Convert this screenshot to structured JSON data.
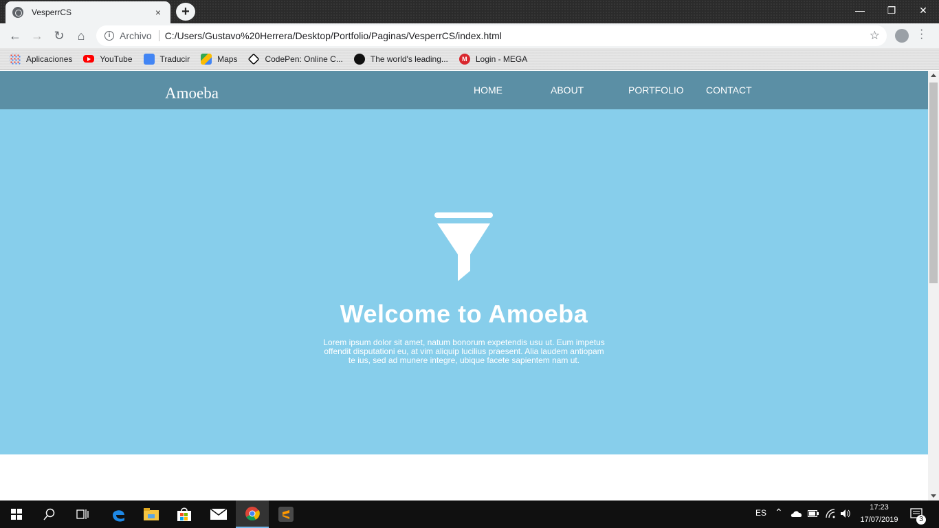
{
  "browser": {
    "tab_title": "VesperrCS",
    "tab_close": "×",
    "new_tab": "+",
    "window_controls": {
      "minimize": "—",
      "restore": "❐",
      "close": "✕"
    },
    "nav": {
      "back": "←",
      "forward": "→",
      "reload": "↻",
      "home": "⌂"
    },
    "omnibox": {
      "security_label": "Archivo",
      "url": "C:/Users/Gustavo%20Herrera/Desktop/Portfolio/Paginas/VesperrCS/index.html",
      "bookmark_star": "☆"
    },
    "bookmarks": [
      {
        "label": "Aplicaciones",
        "icon": "apps-grid-icon"
      },
      {
        "label": "YouTube",
        "icon": "youtube-icon"
      },
      {
        "label": "Traducir",
        "icon": "translate-icon"
      },
      {
        "label": "Maps",
        "icon": "maps-icon"
      },
      {
        "label": "CodePen: Online C...",
        "icon": "codepen-icon"
      },
      {
        "label": "The world's leading...",
        "icon": "github-icon"
      },
      {
        "label": "Login - MEGA",
        "icon": "mega-icon"
      }
    ]
  },
  "site": {
    "brand": "Amoeba",
    "nav": [
      "HOME",
      "ABOUT",
      "PORTFOLIO",
      "CONTACT"
    ],
    "hero": {
      "icon": "funnel-icon",
      "title": "Welcome to Amoeba",
      "text": "Lorem ipsum dolor sit amet, natum bonorum expetendis usu ut. Eum impetus offendit disputationi eu, at vim aliquip lucilius praesent. Alia laudem antiopam te ius, sed ad munere integre, ubique facete sapientem nam ut."
    },
    "colors": {
      "nav_bg": "#5b8fa5",
      "hero_bg": "#87ceeb"
    }
  },
  "taskbar": {
    "apps": [
      "start-icon",
      "search-icon",
      "task-view-icon",
      "edge-icon",
      "file-explorer-icon",
      "store-icon",
      "mail-icon",
      "chrome-icon",
      "sublime-icon"
    ],
    "lang": "ES",
    "time": "17:23",
    "date": "17/07/2019",
    "notifications": "3"
  }
}
